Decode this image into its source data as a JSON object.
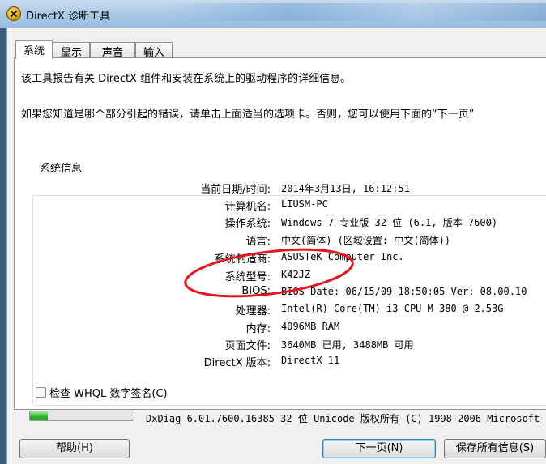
{
  "window": {
    "title": "DirectX 诊断工具",
    "icon": "directx-x-icon"
  },
  "tabs": [
    {
      "label": "系统",
      "active": true
    },
    {
      "label": "显示",
      "active": false
    },
    {
      "label": "声音",
      "active": false
    },
    {
      "label": "输入",
      "active": false
    }
  ],
  "intro": {
    "line1": "该工具报告有关 DirectX 组件和安装在系统上的驱动程序的详细信息。",
    "line2": "如果您知道是哪个部分引起的错误，请单击上面适当的选项卡。否则，您可以使用下面的“下一页”"
  },
  "system_info": {
    "legend": "系统信息",
    "rows": [
      {
        "label": "当前日期/时间:",
        "value": "2014年3月13日, 16:12:51"
      },
      {
        "label": "计算机名:",
        "value": "LIUSM-PC"
      },
      {
        "label": "操作系统:",
        "value": "Windows 7 专业版 32 位 (6.1, 版本 7600)"
      },
      {
        "label": "语言:",
        "value": "中文(简体) (区域设置: 中文(简体))"
      },
      {
        "label": "系统制造商:",
        "value": "ASUSTeK Computer Inc."
      },
      {
        "label": "系统型号:",
        "value": "K42JZ"
      },
      {
        "label": "BIOS:",
        "value": "BIOS Date: 06/15/09 18:50:05 Ver: 08.00.10"
      },
      {
        "label": "处理器:",
        "value": "Intel(R) Core(TM) i3 CPU       M 380  @ 2.53G"
      },
      {
        "label": "内存:",
        "value": "4096MB RAM"
      },
      {
        "label": "页面文件:",
        "value": "3640MB 已用, 3488MB 可用"
      },
      {
        "label": "DirectX 版本:",
        "value": "DirectX 11"
      }
    ]
  },
  "whql_checkbox": {
    "label": "检查 WHQL 数字签名(C)",
    "checked": false
  },
  "progress": {
    "fraction": 0.17
  },
  "copyright": "DxDiag 6.01.7600.16385 32 位 Unicode 版权所有 (C) 1998-2006 Microsoft",
  "buttons": {
    "help": "帮助(H)",
    "next": "下一页(N)",
    "save": "保存所有信息(S)"
  },
  "annotation_color": "#e8141b"
}
